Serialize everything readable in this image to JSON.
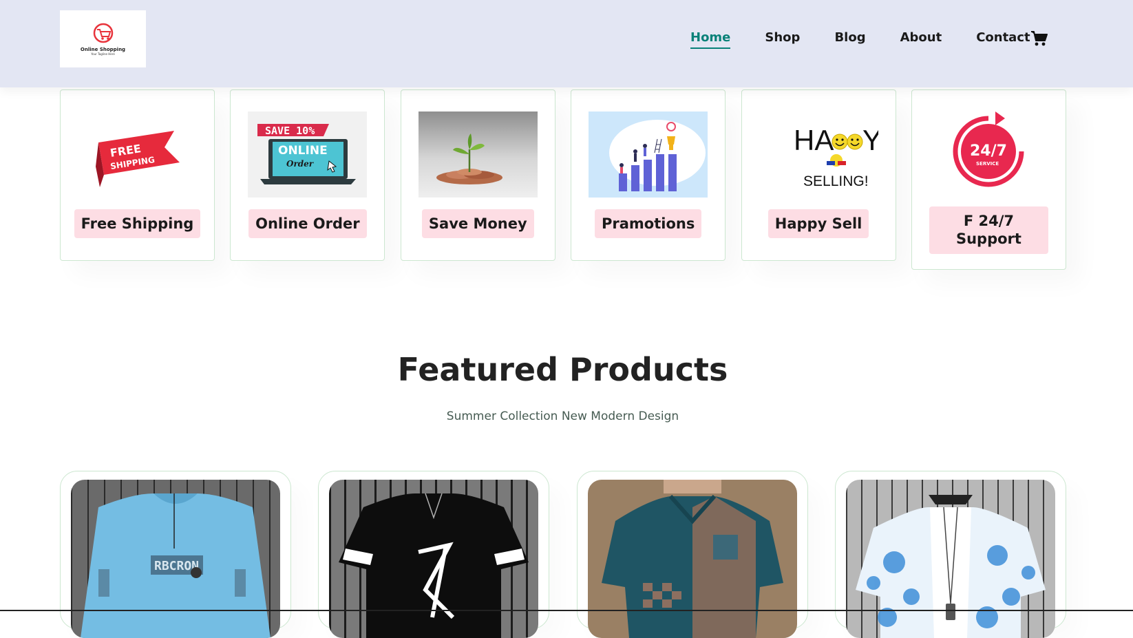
{
  "logo": {
    "text": "Online Shopping",
    "tagline": "Your Tagline Here"
  },
  "nav": {
    "items": [
      {
        "label": "Home",
        "active": true
      },
      {
        "label": "Shop",
        "active": false
      },
      {
        "label": "Blog",
        "active": false
      },
      {
        "label": "About",
        "active": false
      },
      {
        "label": "Contact",
        "active": false
      }
    ],
    "cart_icon": "cart-icon"
  },
  "features": [
    {
      "label": "Free Shipping",
      "image": "free-shipping-ribbon",
      "image_text_1": "FREE",
      "image_text_2": "SHIPPING"
    },
    {
      "label": "Online Order",
      "image": "online-order-laptop",
      "image_text_1": "SAVE 10%",
      "image_text_2": "ONLINE",
      "image_text_3": "Order"
    },
    {
      "label": "Save Money",
      "image": "plant-growing-coins"
    },
    {
      "label": "Pramotions",
      "image": "people-bar-chart-trophy"
    },
    {
      "label": "Happy Sell",
      "image": "happy-selling-smileys",
      "image_text_1": "HA",
      "image_text_2": "Y",
      "image_text_3": "SELLING!"
    },
    {
      "label_line1": "F 24/7",
      "label_line2": "Support",
      "image": "24-7-service-badge",
      "image_text_1": "24/7",
      "image_text_2": "SERVICE"
    }
  ],
  "section": {
    "title": "Featured Products",
    "subtitle": "Summer Collection New Modern Design"
  },
  "products": [
    {
      "image": "light-blue-sweatshirt-photo",
      "image_text": "RBCRON"
    },
    {
      "image": "black-graphic-tshirt-photo"
    },
    {
      "image": "teal-patterned-polo-photo"
    },
    {
      "image": "floral-print-shirt-photo"
    }
  ],
  "colors": {
    "header_bg": "#e3e6f3",
    "accent": "#088178",
    "label_bg": "#fddde4",
    "border": "#cce7d0"
  }
}
